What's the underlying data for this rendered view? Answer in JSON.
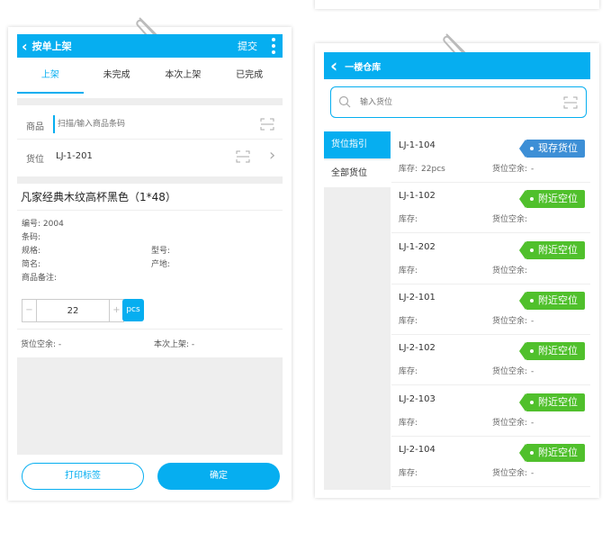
{
  "left": {
    "header": {
      "title": "按单上架",
      "submit": "提交"
    },
    "tabs": [
      {
        "label": "上架",
        "active": true
      },
      {
        "label": "未完成",
        "active": false
      },
      {
        "label": "本次上架",
        "active": false
      },
      {
        "label": "已完成",
        "active": false
      }
    ],
    "goods": {
      "label": "商品",
      "placeholder": "扫描/输入商品条码"
    },
    "location": {
      "label": "货位",
      "value": "LJ-1-201"
    },
    "product": {
      "name": "凡家经典木纹高杯黑色（1*48）",
      "code_label": "编号:",
      "code_value": "2004",
      "barcode_label": "条码:",
      "spec_label": "规格:",
      "model_label": "型号:",
      "short_label": "简名:",
      "origin_label": "产地:",
      "remark_label": "商品备注:"
    },
    "stepper": {
      "minus": "−",
      "value": "22",
      "plus": "+",
      "unit": "pcs"
    },
    "summary": {
      "empty_label": "货位空余:",
      "empty_value": "-",
      "this_label": "本次上架:",
      "this_value": "-"
    },
    "buttons": {
      "print": "打印标签",
      "confirm": "确定"
    }
  },
  "right": {
    "header": {
      "title": "一楼仓库"
    },
    "search": {
      "placeholder": "输入货位"
    },
    "side": [
      {
        "label": "货位指引",
        "active": true
      },
      {
        "label": "全部货位",
        "active": false
      }
    ],
    "stock_label": "库存:",
    "space_label": "货位空余:",
    "locations": [
      {
        "name": "LJ-1-104",
        "stock": "22pcs",
        "space": "-",
        "tag": "现存货位",
        "tag_color": "#3d8fd6"
      },
      {
        "name": "LJ-1-102",
        "stock": "",
        "space": "",
        "tag": "附近空位",
        "tag_color": "#50c02c"
      },
      {
        "name": "LJ-1-202",
        "stock": "",
        "space": "",
        "tag": "附近空位",
        "tag_color": "#50c02c"
      },
      {
        "name": "LJ-2-101",
        "stock": "",
        "space": "-",
        "tag": "附近空位",
        "tag_color": "#50c02c"
      },
      {
        "name": "LJ-2-102",
        "stock": "",
        "space": "-",
        "tag": "附近空位",
        "tag_color": "#50c02c"
      },
      {
        "name": "LJ-2-103",
        "stock": "",
        "space": "-",
        "tag": "附近空位",
        "tag_color": "#50c02c"
      },
      {
        "name": "LJ-2-104",
        "stock": "",
        "space": "-",
        "tag": "附近空位",
        "tag_color": "#50c02c"
      }
    ]
  },
  "colors": {
    "primary": "#06aef0",
    "tag_current": "#3d8fd6",
    "tag_nearby": "#50c02c"
  }
}
